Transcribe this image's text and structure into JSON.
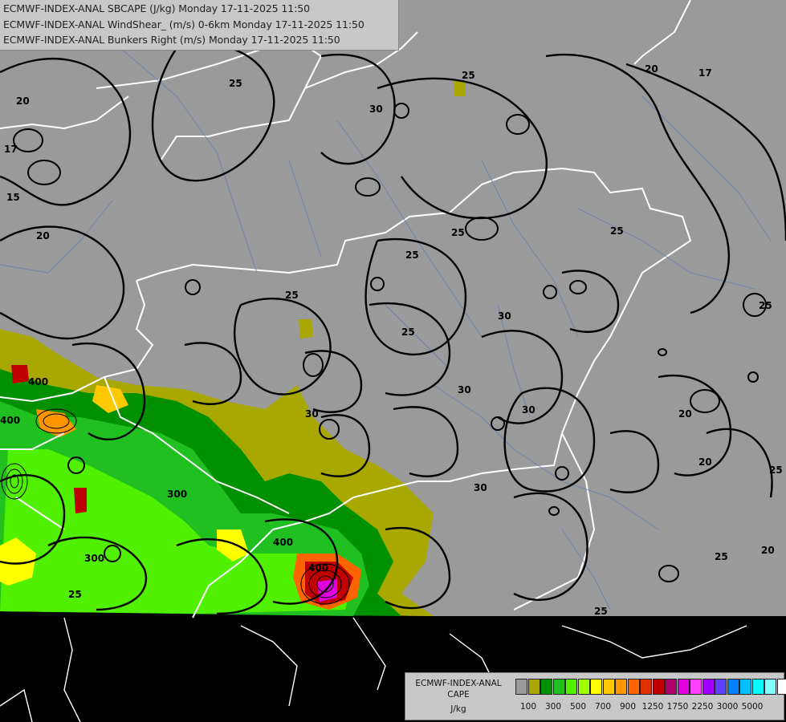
{
  "header": {
    "line1": "ECMWF-INDEX-ANAL SBCAPE (J/kg) Monday 17-11-2025 11:50",
    "line2": "ECMWF-INDEX-ANAL WindShear_ (m/s) 0-6km Monday 17-11-2025 11:50",
    "line3": "ECMWF-INDEX-ANAL Bunkers Right (m/s) Monday 17-11-2025 11:50"
  },
  "legend": {
    "title1": "ECMWF-INDEX-ANAL",
    "title2": "CAPE",
    "title3": "J/kg",
    "colors": [
      "#9a9a9a",
      "#a8a800",
      "#009000",
      "#20c020",
      "#50f000",
      "#a0ff00",
      "#ffff00",
      "#ffc800",
      "#ff9600",
      "#ff6400",
      "#e03000",
      "#c00000",
      "#b0006a",
      "#e000e0",
      "#ff40ff",
      "#a000ff",
      "#6040ff",
      "#0080ff",
      "#00c0ff",
      "#00ffff",
      "#80ffff",
      "#ffffff"
    ],
    "ticks": [
      "100",
      "300",
      "500",
      "700",
      "900",
      "1250",
      "1750",
      "2250",
      "3000",
      "5000"
    ]
  },
  "contour_labels": {
    "shear": [
      "20",
      "17",
      "25",
      "30",
      "25",
      "20",
      "17",
      "15",
      "20",
      "25",
      "25",
      "30",
      "25",
      "25",
      "30",
      "30",
      "30",
      "25",
      "25",
      "20",
      "20",
      "25",
      "20",
      "25",
      "25",
      "30",
      "25"
    ],
    "cape": [
      "400",
      "400",
      "300",
      "400",
      "300",
      "400"
    ]
  }
}
